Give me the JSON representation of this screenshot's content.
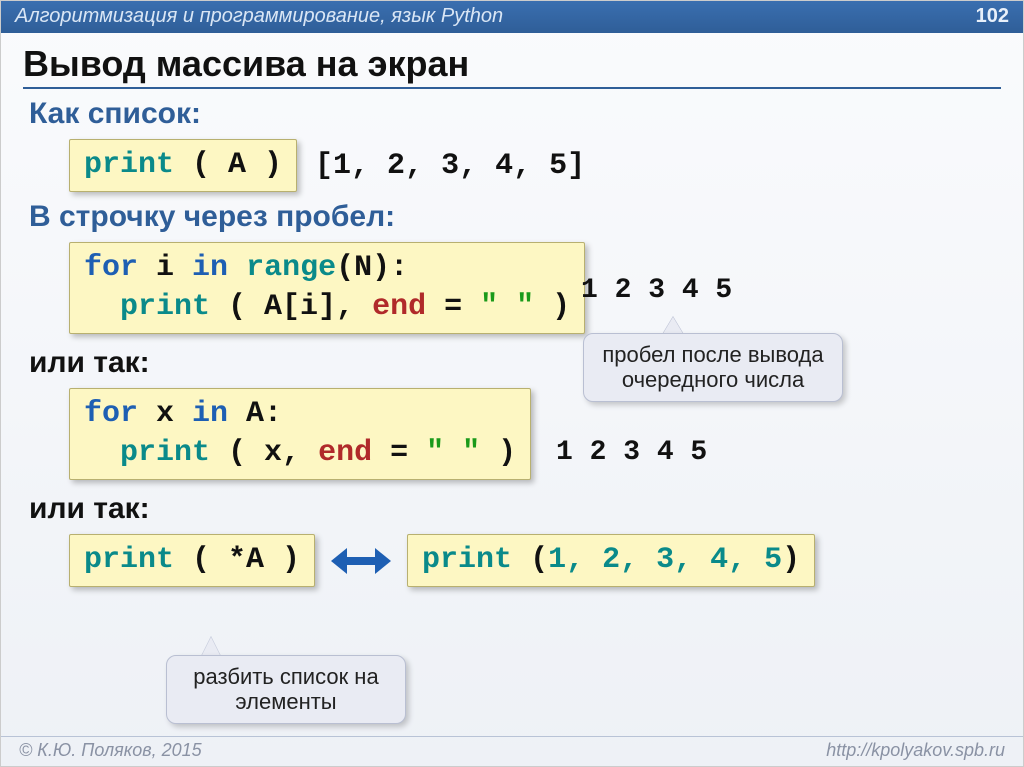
{
  "header": {
    "title": "Алгоритмизация и программирование, язык Python",
    "page": "102"
  },
  "title": "Вывод массива на экран",
  "s1": {
    "label": "Как список:",
    "code": {
      "print": "print",
      "rest": " ( A )"
    },
    "output": "[1, 2, 3, 4, 5]"
  },
  "s2": {
    "label": "В строчку через пробел:",
    "code": {
      "l1_for": "for",
      "l1_mid": " i ",
      "l1_in": "in",
      "l1_sp": " ",
      "l1_range": "range",
      "l1_tail": "(N):",
      "l2_ind": "  ",
      "l2_print": "print",
      "l2_mid": " ( A[i], ",
      "l2_end": "end",
      "l2_eq": " = ",
      "l2_str": "\" \"",
      "l2_close": " )"
    },
    "output": "1 2 3 4 5",
    "tip": "пробел после вывода очередного числа"
  },
  "s3": {
    "label": "или так:",
    "code": {
      "l1_for": "for",
      "l1_mid": " x ",
      "l1_in": "in",
      "l1_tail": " A:",
      "l2_ind": "  ",
      "l2_print": "print",
      "l2_mid": " ( x, ",
      "l2_end": "end",
      "l2_eq": " = ",
      "l2_str": "\" \"",
      "l2_close": " )"
    },
    "output": "1 2 3 4 5"
  },
  "s4": {
    "label": "или так:",
    "left": {
      "print": "print",
      "rest": " ( *A )"
    },
    "right": {
      "print": "print",
      "open": " (",
      "nums": "1, 2, 3, 4, 5",
      "close": ")"
    },
    "tip": "разбить список на элементы"
  },
  "footer": {
    "left": "© К.Ю. Поляков, 2015",
    "right": "http://kpolyakov.spb.ru"
  }
}
